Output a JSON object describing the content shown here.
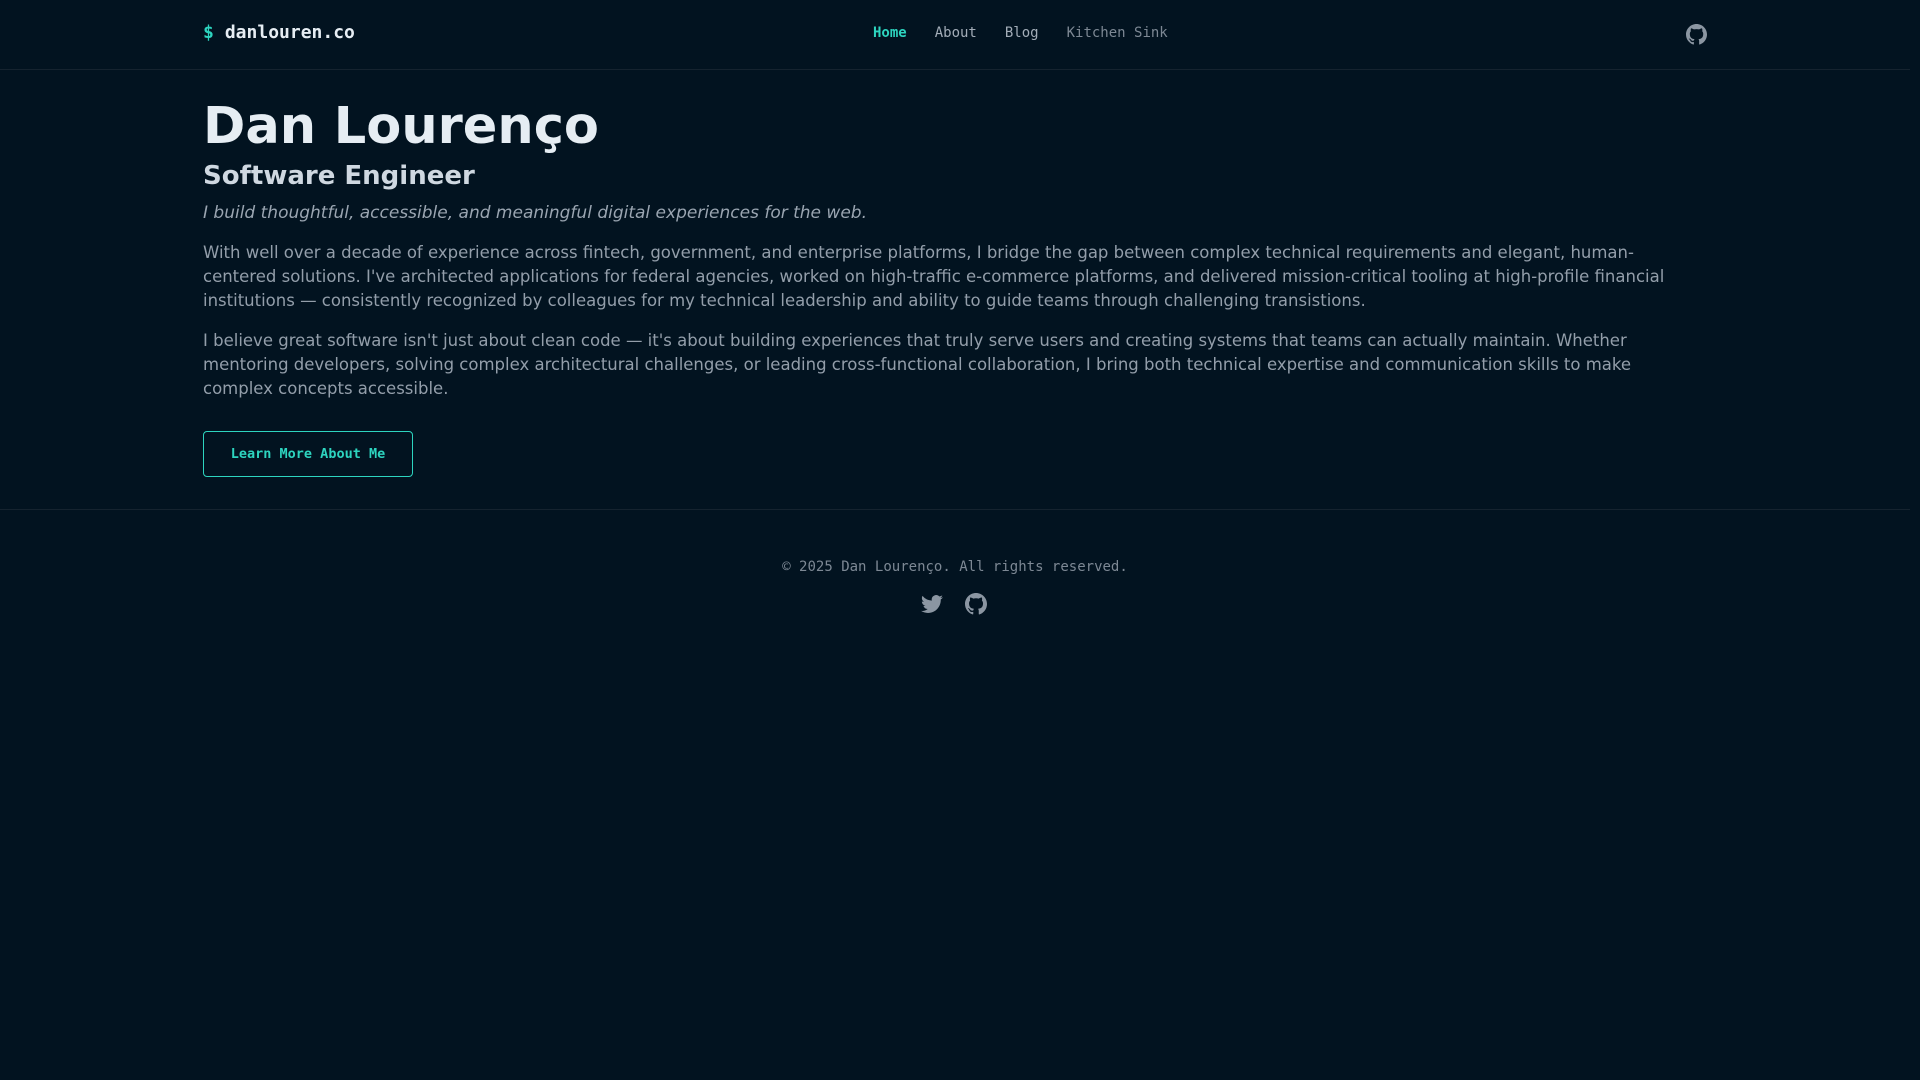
{
  "header": {
    "brand_prompt": "$",
    "brand_name": "danlouren.co",
    "nav": [
      {
        "label": "Home",
        "state": "active"
      },
      {
        "label": "About",
        "state": "normal"
      },
      {
        "label": "Blog",
        "state": "normal"
      },
      {
        "label": "Kitchen Sink",
        "state": "muted"
      }
    ],
    "github_icon": "github-icon"
  },
  "hero": {
    "name": "Dan Lourenço",
    "role": "Software Engineer",
    "tagline": "I build thoughtful, accessible, and meaningful digital experiences for the web.",
    "paragraphs": [
      "With well over a decade of experience across fintech, government, and enterprise platforms, I bridge the gap between complex technical requirements and elegant, human-centered solutions. I've architected applications for federal agencies, worked on high-traffic e-commerce platforms, and delivered mission-critical tooling at high-profile financial institutions — consistently recognized by colleagues for my technical leadership and ability to guide teams through challenging transistions.",
      "I believe great software isn't just about clean code — it's about building experiences that truly serve users and creating systems that teams can actually maintain. Whether mentoring developers, solving complex architectural challenges, or leading cross-functional collaboration, I bring both technical expertise and communication skills to make complex concepts accessible."
    ],
    "cta_label": "Learn More About Me"
  },
  "footer": {
    "copyright": "© 2025 Dan Lourenço. All rights reserved.",
    "social_icons": [
      "twitter-icon",
      "github-icon"
    ]
  },
  "colors": {
    "background": "#021320",
    "accent": "#2dd4bf",
    "heading": "#e6edf3",
    "body_text": "#939eaa",
    "border": "#15232f"
  }
}
